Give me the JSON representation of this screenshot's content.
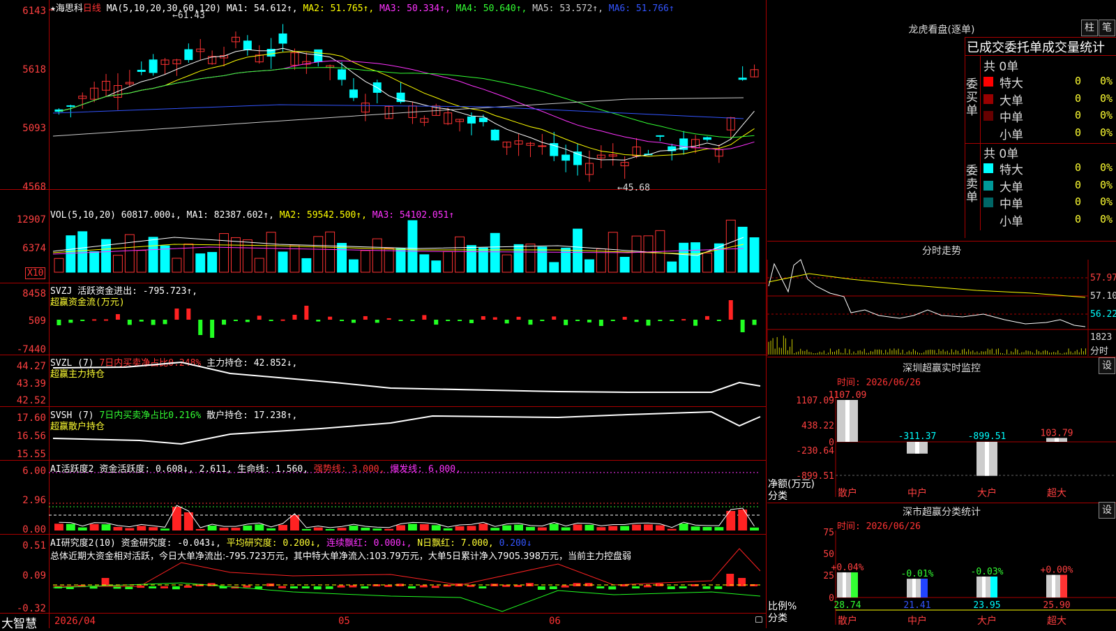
{
  "main": {
    "star": "★",
    "name": "海思科",
    "period": "日线",
    "ma_label": "MA(5,10,20,30,60,120)",
    "ma": [
      {
        "name": "MA1:",
        "value": "54.612↑,",
        "color": "#ffffff"
      },
      {
        "name": "MA2:",
        "value": "51.765↑,",
        "color": "#ffff00"
      },
      {
        "name": "MA3:",
        "value": "50.334↑,",
        "color": "#ff33ff"
      },
      {
        "name": "MA4:",
        "value": "50.640↑,",
        "color": "#33ff33"
      },
      {
        "name": "MA5:",
        "value": "53.572↑,",
        "color": "#cccccc"
      },
      {
        "name": "MA6:",
        "value": "51.766↑",
        "color": "#3355ff"
      }
    ],
    "y_ticks": [
      "6143",
      "5618",
      "5093",
      "4568"
    ],
    "high_label": "←61.43",
    "low_label": "←45.68",
    "colors": {
      "up": "#ff3333",
      "down": "#00ffff"
    }
  },
  "vol": {
    "label": "VOL(5,10,20)",
    "value": "60817.000↓,",
    "ma": [
      {
        "name": "MA1:",
        "value": "82387.602↑,",
        "color": "#ffffff"
      },
      {
        "name": "MA2:",
        "value": "59542.500↑,",
        "color": "#ffff00"
      },
      {
        "name": "MA3:",
        "value": "54102.051↑",
        "color": "#ff33ff"
      }
    ],
    "y_ticks": [
      "12907",
      "6374"
    ],
    "unit": "X10"
  },
  "svzj": {
    "line1_a": "SVZJ",
    "line1_b": "活跃资金进出:",
    "line1_c": "-795.723↑,",
    "line2": "超赢资金流(万元)",
    "y_ticks": [
      "8458",
      "509",
      "-7440"
    ]
  },
  "svzl": {
    "label": "SVZL (7)",
    "info": "7日内买卖净占比0.248%",
    "hold": "主力持仓: 42.852↓,",
    "sub": "超赢主力持仓",
    "y_ticks": [
      "44.27",
      "43.39",
      "42.52"
    ]
  },
  "svsh": {
    "label": "SVSH (7)",
    "info": "7日内买卖净占比0.216%",
    "hold": "散户持仓: 17.238↑,",
    "sub": "超赢散户持仓",
    "y_ticks": [
      "17.60",
      "16.56",
      "15.55"
    ]
  },
  "ai1": {
    "label": "AI活跃度2",
    "a": "资金活跃度: 0.608↓,",
    "b": "2.611,",
    "c": "生命线: 1.560,",
    "d": "强势线: 3.000,",
    "e": "爆发线: 6.000,",
    "y_ticks": [
      "6.00",
      "2.96",
      "0.00"
    ]
  },
  "ai2": {
    "label": "AI研究度2(10)",
    "a": "资金研究度: -0.043↓,",
    "b": "平均研究度: 0.200↓,",
    "c": "连续飘红: 0.000↓,",
    "d": "N日飘红: 7.000,",
    "e": "0.200↓",
    "summary": "总体近期大资金相对活跃，今日大单净流出:-795.723万元，其中特大单净流入:103.79万元，大单5日累计净入7905.398万元，当前主力控盘弱",
    "y_ticks": [
      "0.51",
      "0.09",
      "-0.32"
    ]
  },
  "bottom": {
    "brand": "大智慧",
    "date": "2026/04",
    "m1": "05",
    "m2": "06"
  },
  "lhb": {
    "title": "龙虎看盘(逐单)",
    "btn1": "柱",
    "btn2": "笔",
    "header": "已成交委托单成交量统计",
    "buy_label": "委买单",
    "sell_label": "委卖单",
    "buy_total": "共 0单",
    "sell_total": "共 0单",
    "buy_rows": [
      {
        "name": "特大",
        "v": "0",
        "p": "0%",
        "color": "#ff0000"
      },
      {
        "name": "大单",
        "v": "0",
        "p": "0%",
        "color": "#990000"
      },
      {
        "name": "中单",
        "v": "0",
        "p": "0%",
        "color": "#660000"
      },
      {
        "name": "小单",
        "v": "0",
        "p": "0%",
        "color": ""
      }
    ],
    "sell_rows": [
      {
        "name": "特大",
        "v": "0",
        "p": "0%",
        "color": "#00ffff"
      },
      {
        "name": "大单",
        "v": "0",
        "p": "0%",
        "color": "#009999"
      },
      {
        "name": "中单",
        "v": "0",
        "p": "0%",
        "color": "#006666"
      },
      {
        "name": "小单",
        "v": "0",
        "p": "0%",
        "color": ""
      }
    ]
  },
  "fs": {
    "title": "分时走势",
    "prices": [
      "57.97",
      "57.10",
      "56.22"
    ],
    "vol": "1823",
    "unit": "分时"
  },
  "sz": {
    "title": "深圳超赢实时监控",
    "btn": "设",
    "time": "时间: 2026/06/26",
    "y_ticks": [
      "1107.09",
      "438.22",
      "0",
      "-230.64",
      "-899.51"
    ],
    "bars": [
      {
        "cat": "散户",
        "val": "1107.09",
        "num": 1107.09
      },
      {
        "cat": "中户",
        "val": "-311.37",
        "num": -311.37
      },
      {
        "cat": "大户",
        "val": "-899.51",
        "num": -899.51
      },
      {
        "cat": "超大",
        "val": "103.79",
        "num": 103.79
      }
    ],
    "ylabel1": "净额(万元)",
    "ylabel2": "分类"
  },
  "sc": {
    "title": "深市超赢分类统计",
    "btn": "设",
    "time": "时间: 2026/06/26",
    "y_ticks": [
      "75",
      "50",
      "25",
      "0"
    ],
    "bars": [
      {
        "cat": "散户",
        "pct": "+0.04%",
        "val": "28.74",
        "num": 28.74,
        "color": "#33ff33"
      },
      {
        "cat": "中户",
        "pct": "-0.01%",
        "val": "21.41",
        "num": 21.41,
        "color": "#2244ff"
      },
      {
        "cat": "大户",
        "pct": "-0.03%",
        "val": "23.95",
        "num": 23.95,
        "color": "#00ffff"
      },
      {
        "cat": "超大",
        "pct": "+0.00%",
        "val": "25.90",
        "num": 25.9,
        "color": "#ff3333"
      }
    ],
    "ylabel1": "比例%",
    "ylabel2": "分类"
  }
}
